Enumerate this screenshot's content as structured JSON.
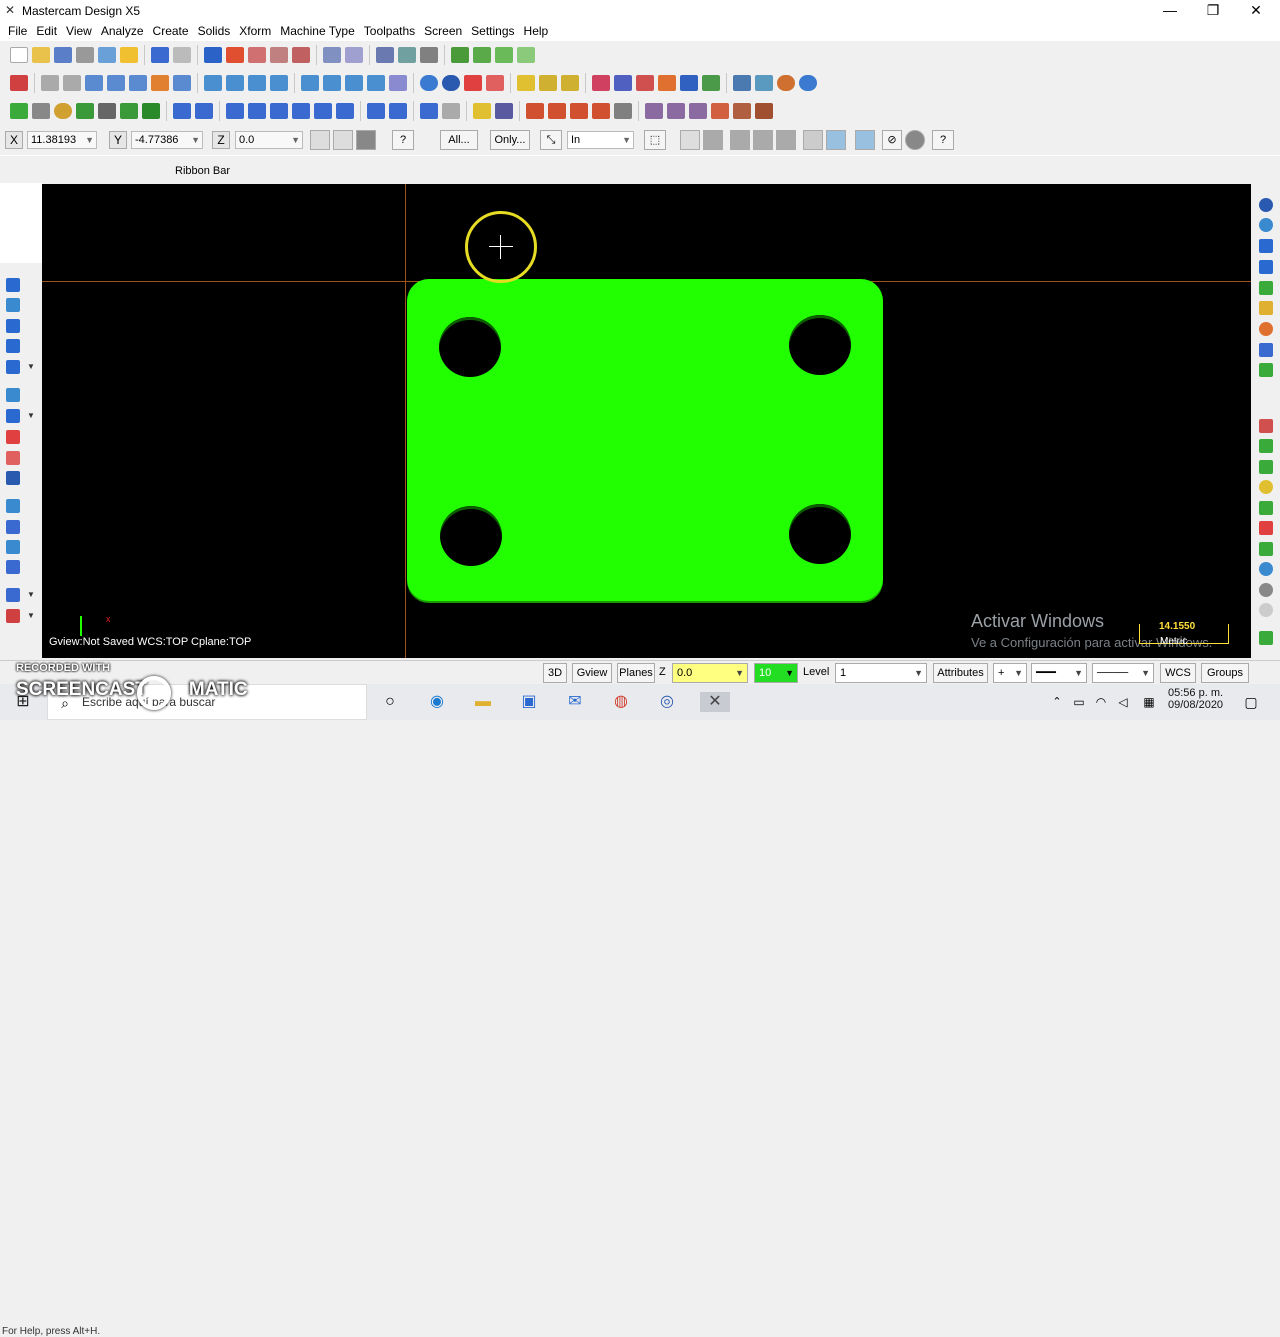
{
  "window": {
    "title": "Mastercam Design X5",
    "minimize": "—",
    "maximize": "❐",
    "close": "✕"
  },
  "menu": [
    "File",
    "Edit",
    "View",
    "Analyze",
    "Create",
    "Solids",
    "Xform",
    "Machine Type",
    "Toolpaths",
    "Screen",
    "Settings",
    "Help"
  ],
  "coordbar": {
    "x_label": "X",
    "x_value": "11.38193",
    "y_label": "Y",
    "y_value": "-4.77386",
    "z_label": "Z",
    "z_value": "0.0",
    "all_button": "All...",
    "only_button": "Only...",
    "mode_value": "In"
  },
  "ribbon": {
    "label": "Ribbon Bar"
  },
  "viewport": {
    "status": "Gview:Not Saved   WCS:TOP   Cplane:TOP",
    "triad_x": "x",
    "activate_title": "Activar Windows",
    "activate_sub": "Ve a Configuración para activar Windows.",
    "scale_value": "14.1550",
    "scale_unit": "Metric",
    "plate_color": "#22ff00"
  },
  "statusbar": {
    "mode_3d": "3D",
    "gview": "Gview",
    "planes": "Planes",
    "z_label": "Z",
    "z_value": "0.0",
    "color_value": "10",
    "level_label": "Level",
    "level_value": "1",
    "attributes": "Attributes",
    "wcs": "WCS",
    "groups": "Groups",
    "help_hint": "For Help, press Alt+H."
  },
  "taskbar": {
    "search_placeholder": "Escribe aquí para buscar",
    "time": "05:56 p. m.",
    "date": "09/08/2020"
  },
  "watermark": {
    "line1": "RECORDED WITH",
    "line2": "SCREENCAST",
    "line3": "MATIC"
  }
}
